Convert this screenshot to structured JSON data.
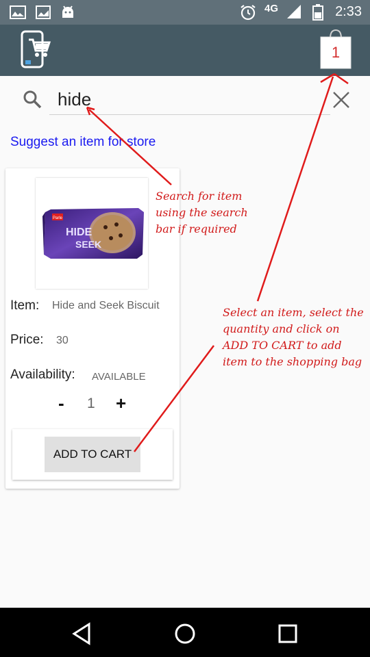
{
  "status_bar": {
    "network": "4G",
    "time": "2:33"
  },
  "header": {
    "cart_count": "1"
  },
  "search": {
    "query": "hide"
  },
  "suggest_link": "Suggest an item for store",
  "product": {
    "item_label": "Item:",
    "item_name": "Hide and Seek Biscuit",
    "price_label": "Price:",
    "price": "30",
    "availability_label": "Availability:",
    "availability": "AVAILABLE",
    "qty_minus": "-",
    "quantity": "1",
    "qty_plus": "+",
    "add_to_cart": "ADD TO CART",
    "package": {
      "brand": "Parle",
      "line1": "HIDE",
      "line2": "SEEK"
    }
  },
  "annotations": {
    "search_hint": "Search for item\nusing the search\nbar if required",
    "cart_hint": "Select an item, select the\nquantity and click on\nADD TO CART to add\nitem to the shopping bag"
  },
  "colors": {
    "app_bar": "#455a64",
    "status_bar": "#607079",
    "link": "#1a1af0",
    "annotation": "#d11a1a",
    "cart_badge": "#d32f2f"
  }
}
